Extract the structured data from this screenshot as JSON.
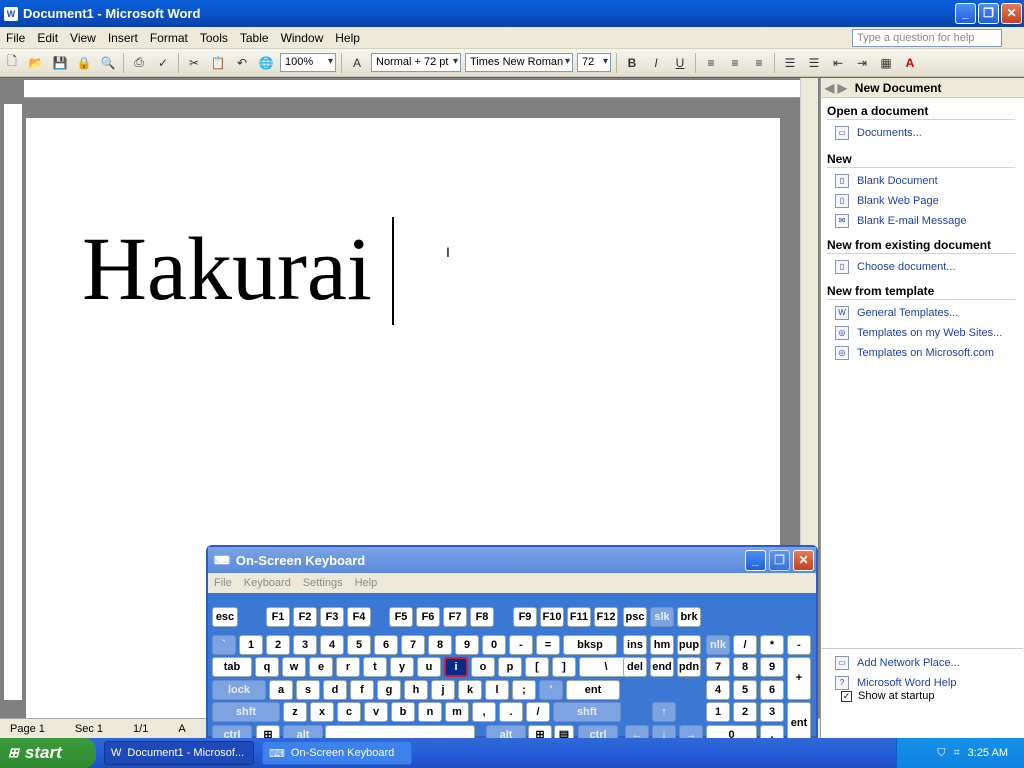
{
  "window": {
    "title": "Document1 - Microsoft Word",
    "icon": "word-icon"
  },
  "menu": [
    "File",
    "Edit",
    "View",
    "Insert",
    "Format",
    "Tools",
    "Table",
    "Window",
    "Help"
  ],
  "help_placeholder": "Type a question for help",
  "toolbar": {
    "zoom": "100%",
    "style": "Normal + 72 pt",
    "font": "Times New Roman",
    "size": "72",
    "bold": "B",
    "italic": "I",
    "underline": "U"
  },
  "document": {
    "text": "Hakurai"
  },
  "status": {
    "page": "Page 1",
    "sec": "Sec 1",
    "pages": "1/1",
    "at": "A"
  },
  "taskpane": {
    "title": "New Document",
    "sections": [
      {
        "title": "Open a document",
        "links": [
          "Documents..."
        ]
      },
      {
        "title": "New",
        "links": [
          "Blank Document",
          "Blank Web Page",
          "Blank E-mail Message"
        ]
      },
      {
        "title": "New from existing document",
        "links": [
          "Choose document..."
        ]
      },
      {
        "title": "New from template",
        "links": [
          "General Templates...",
          "Templates on my Web Sites...",
          "Templates on Microsoft.com"
        ]
      }
    ],
    "bottom_links": [
      "Add Network Place...",
      "Microsoft Word Help"
    ],
    "show_startup": "Show at startup"
  },
  "osk": {
    "title": "On-Screen Keyboard",
    "menu": [
      "File",
      "Keyboard",
      "Settings",
      "Help"
    ],
    "keys": [
      "esc",
      "F1",
      "F2",
      "F3",
      "F4",
      "F5",
      "F6",
      "F7",
      "F8",
      "F9",
      "F10",
      "F11",
      "F12",
      "psc",
      "slk",
      "brk",
      "`",
      "1",
      "2",
      "3",
      "4",
      "5",
      "6",
      "7",
      "8",
      "9",
      "0",
      "-",
      "=",
      "bksp",
      "ins",
      "hm",
      "pup",
      "nlk",
      "/",
      "*",
      "-",
      "tab",
      "q",
      "w",
      "e",
      "r",
      "t",
      "y",
      "u",
      "i",
      "o",
      "p",
      "[",
      "]",
      "\\",
      "del",
      "end",
      "pdn",
      "7",
      "8",
      "9",
      "+",
      "lock",
      "a",
      "s",
      "d",
      "f",
      "g",
      "h",
      "j",
      "k",
      "l",
      ";",
      "'",
      "ent",
      "4",
      "5",
      "6",
      "shft",
      "z",
      "x",
      "c",
      "v",
      "b",
      "n",
      "m",
      ",",
      ".",
      "/",
      "shft",
      "↑",
      "1",
      "2",
      "3",
      "ent",
      "ctrl",
      "alt",
      "alt",
      "ctrl",
      "←",
      "↓",
      "→",
      "0",
      "."
    ]
  },
  "taskbar": {
    "start": "start",
    "tasks": [
      "Document1 - Microsof...",
      "On-Screen Keyboard"
    ],
    "clock": "3:25 AM"
  }
}
